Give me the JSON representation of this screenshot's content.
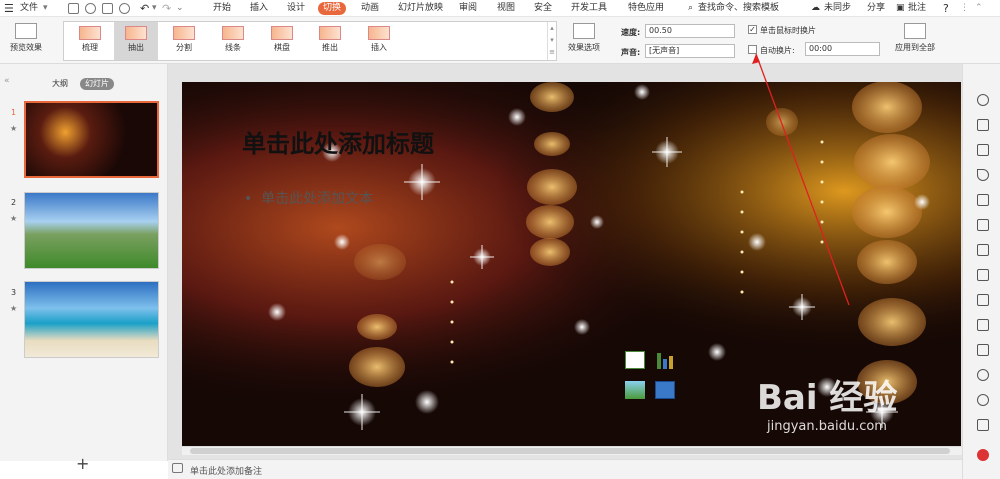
{
  "menubar": {
    "file_label": "文件",
    "tabs": [
      "开始",
      "插入",
      "设计",
      "切换",
      "动画",
      "幻灯片放映",
      "审阅",
      "视图",
      "安全",
      "开发工具",
      "特色应用"
    ],
    "active_tab": "切换",
    "search_text": "查找命令、搜索模板",
    "sync_label": "未同步",
    "share_label": "分享",
    "comment_label": "批注",
    "help_label": "?"
  },
  "ribbon": {
    "preview_label": "预览效果",
    "gallery": [
      {
        "label": "梳理",
        "selected": false
      },
      {
        "label": "抽出",
        "selected": true
      },
      {
        "label": "分割",
        "selected": false
      },
      {
        "label": "线条",
        "selected": false
      },
      {
        "label": "棋盘",
        "selected": false
      },
      {
        "label": "推出",
        "selected": false
      },
      {
        "label": "插入",
        "selected": false
      }
    ],
    "effect_options_label": "效果选项",
    "speed_label": "速度:",
    "speed_value": "00.50",
    "sound_label": "声音:",
    "sound_value": "[无声音]",
    "on_click_label": "单击鼠标时换片",
    "on_click_checked": true,
    "auto_label": "自动换片:",
    "auto_checked": false,
    "auto_value": "00:00",
    "apply_all_label": "应用到全部"
  },
  "left_pane": {
    "tab_outline": "大纲",
    "tab_slides": "幻灯片",
    "slides": [
      {
        "number": "1",
        "star": "★",
        "selected": true
      },
      {
        "number": "2",
        "star": "★",
        "selected": false
      },
      {
        "number": "3",
        "star": "★",
        "selected": false
      }
    ],
    "add_label": "+",
    "collapse_label": "«"
  },
  "slide": {
    "title": "单击此处添加标题",
    "body": "单击此处添加文本"
  },
  "status": {
    "notes_placeholder": "单击此处添加备注"
  },
  "watermark": {
    "brand": "Bai 经验",
    "url": "jingyan.baidu.com"
  },
  "colors": {
    "accent": "#e8683b",
    "annotation_arrow": "#e02020"
  }
}
